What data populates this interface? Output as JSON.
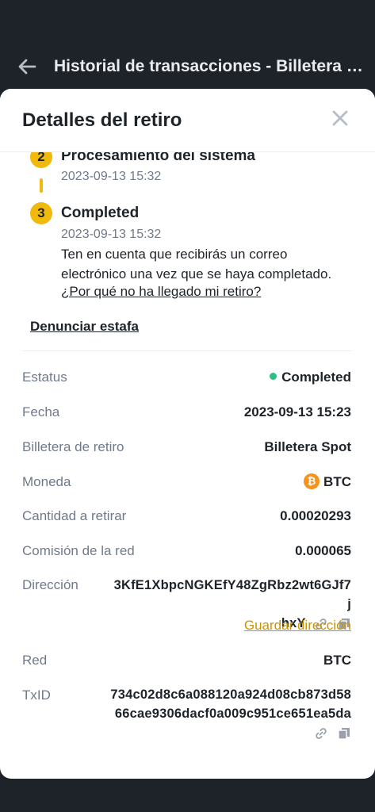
{
  "topbar": {
    "title": "Historial de transacciones - Billetera -..."
  },
  "sheet": {
    "title": "Detalles del retiro",
    "steps": [
      {
        "number": "2",
        "title": "Procesamiento del sistema",
        "time": "2023-09-13 15:32"
      },
      {
        "number": "3",
        "title": "Completed",
        "time": "2023-09-13 15:32",
        "note": "Ten en cuenta que recibirás un correo electrónico una vez que se haya completado.",
        "link": "¿Por qué no ha llegado mi retiro?"
      }
    ],
    "report_link": "Denunciar estafa",
    "details": {
      "status": {
        "label": "Estatus",
        "value": "Completed"
      },
      "date": {
        "label": "Fecha",
        "value": "2023-09-13 15:23"
      },
      "wallet": {
        "label": "Billetera de retiro",
        "value": "Billetera Spot"
      },
      "coin": {
        "label": "Moneda",
        "value": "BTC",
        "icon_letter": "₿"
      },
      "amount": {
        "label": "Cantidad a retirar",
        "value": "0.00020293"
      },
      "fee": {
        "label": "Comisión de la red",
        "value": "0.000065"
      },
      "address": {
        "label": "Dirección",
        "line1": "3KfE1XbpcNGKEfY48ZgRbz2wt6GJf7j",
        "line2": "hxY",
        "save": "Guardar dirección"
      },
      "network": {
        "label": "Red",
        "value": "BTC"
      },
      "txid": {
        "label": "TxID",
        "line1": "734c02d8c6a088120a924d08cb873d58",
        "line2": "66cae9306dacf0a009c951ce651ea5da"
      }
    }
  },
  "colors": {
    "accent": "#f0b90b",
    "success": "#2ebd85",
    "link": "#c99400",
    "dark": "#1e2329",
    "muted": "#707a8a"
  },
  "icons": [
    "back-arrow-icon",
    "close-icon",
    "link-icon",
    "copy-icon",
    "btc-coin-icon",
    "status-dot-icon"
  ]
}
